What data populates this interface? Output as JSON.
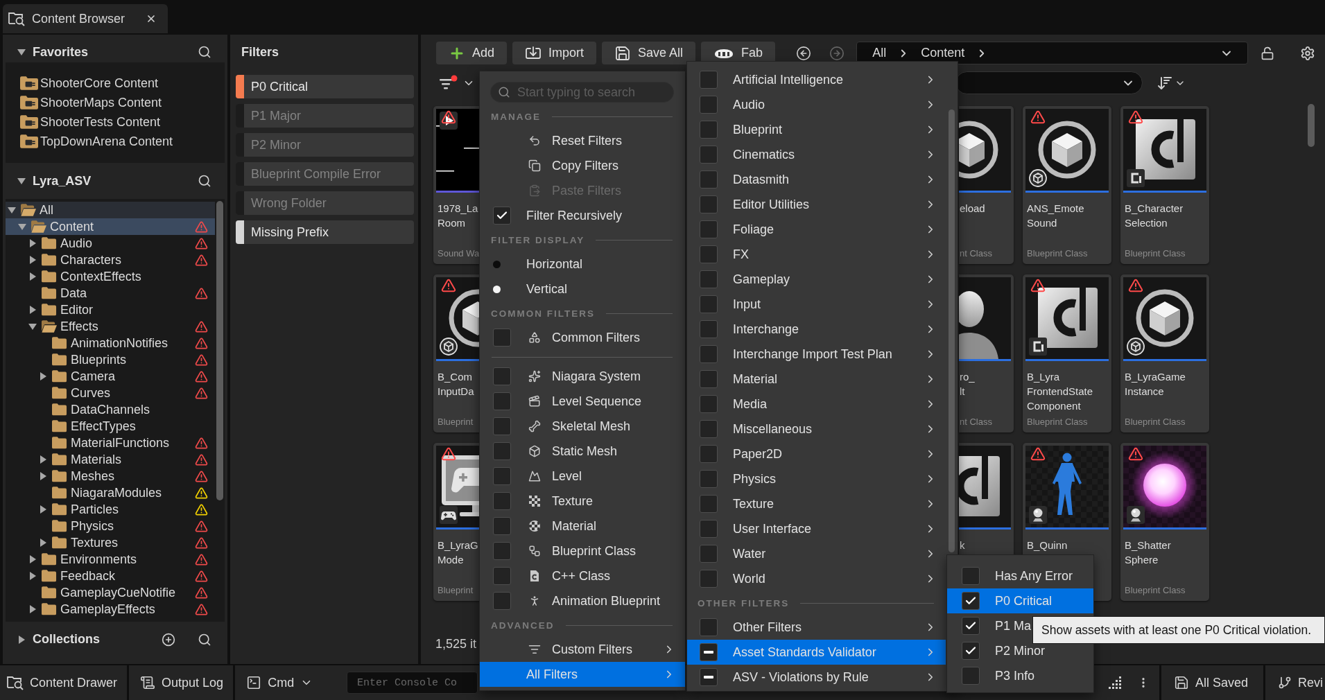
{
  "tab": {
    "title": "Content Browser"
  },
  "sidebar": {
    "favorites": {
      "title": "Favorites",
      "expanded": true,
      "items": [
        "ShooterCore Content",
        "ShooterMaps Content",
        "ShooterTests Content",
        "TopDownArena Content"
      ]
    },
    "project": {
      "title": "Lyra_ASV",
      "expanded": true,
      "tree": [
        {
          "label": "All",
          "kind": "branch",
          "expanded": true,
          "warning": false,
          "selected": false,
          "hovered": true,
          "children": [
            {
              "label": "Content",
              "kind": "branch",
              "expanded": true,
              "warning": true,
              "color": "#f04a4a",
              "selected": true,
              "hovered": false,
              "children": [
                {
                  "label": "Audio",
                  "kind": "branch",
                  "expanded": false,
                  "warning": true,
                  "color": "#f04a4a",
                  "selected": false,
                  "hovered": false
                },
                {
                  "label": "Characters",
                  "kind": "branch",
                  "expanded": false,
                  "warning": true,
                  "color": "#f04a4a",
                  "selected": false,
                  "hovered": false
                },
                {
                  "label": "ContextEffects",
                  "kind": "branch",
                  "expanded": false,
                  "warning": false,
                  "selected": false,
                  "hovered": false
                },
                {
                  "label": "Data",
                  "kind": "leaf",
                  "warning": true,
                  "color": "#f04a4a",
                  "selected": false,
                  "hovered": false
                },
                {
                  "label": "Editor",
                  "kind": "branch",
                  "expanded": false,
                  "warning": false,
                  "selected": false,
                  "hovered": false
                },
                {
                  "label": "Effects",
                  "kind": "branch",
                  "expanded": true,
                  "warning": true,
                  "color": "#f04a4a",
                  "selected": false,
                  "hovered": false,
                  "children": [
                    {
                      "label": "AnimationNotifies",
                      "kind": "leaf",
                      "warning": true,
                      "color": "#f04a4a",
                      "selected": false,
                      "hovered": false
                    },
                    {
                      "label": "Blueprints",
                      "kind": "leaf",
                      "warning": true,
                      "color": "#f04a4a",
                      "selected": false,
                      "hovered": false
                    },
                    {
                      "label": "Camera",
                      "kind": "branch",
                      "expanded": false,
                      "warning": true,
                      "color": "#f04a4a",
                      "selected": false,
                      "hovered": false
                    },
                    {
                      "label": "Curves",
                      "kind": "leaf",
                      "warning": true,
                      "color": "#f04a4a",
                      "selected": false,
                      "hovered": false
                    },
                    {
                      "label": "DataChannels",
                      "kind": "leaf",
                      "warning": false,
                      "selected": false,
                      "hovered": false
                    },
                    {
                      "label": "EffectTypes",
                      "kind": "leaf",
                      "warning": false,
                      "selected": false,
                      "hovered": false
                    },
                    {
                      "label": "MaterialFunctions",
                      "kind": "leaf",
                      "warning": true,
                      "color": "#f04a4a",
                      "selected": false,
                      "hovered": false
                    },
                    {
                      "label": "Materials",
                      "kind": "branch",
                      "expanded": false,
                      "warning": true,
                      "color": "#f04a4a",
                      "selected": false,
                      "hovered": false
                    },
                    {
                      "label": "Meshes",
                      "kind": "branch",
                      "expanded": false,
                      "warning": true,
                      "color": "#f04a4a",
                      "selected": false,
                      "hovered": false
                    },
                    {
                      "label": "NiagaraModules",
                      "kind": "leaf",
                      "warning": true,
                      "color": "#f2d000",
                      "selected": false,
                      "hovered": false
                    },
                    {
                      "label": "Particles",
                      "kind": "branch",
                      "expanded": false,
                      "warning": true,
                      "color": "#f2d000",
                      "selected": false,
                      "hovered": false
                    },
                    {
                      "label": "Physics",
                      "kind": "leaf",
                      "warning": true,
                      "color": "#f04a4a",
                      "selected": false,
                      "hovered": false
                    },
                    {
                      "label": "Textures",
                      "kind": "branch",
                      "expanded": false,
                      "warning": true,
                      "color": "#f04a4a",
                      "selected": false,
                      "hovered": false
                    }
                  ]
                },
                {
                  "label": "Environments",
                  "kind": "branch",
                  "expanded": false,
                  "warning": true,
                  "color": "#f04a4a",
                  "selected": false,
                  "hovered": false
                },
                {
                  "label": "Feedback",
                  "kind": "branch",
                  "expanded": false,
                  "warning": true,
                  "color": "#f04a4a",
                  "selected": false,
                  "hovered": false
                },
                {
                  "label": "GameplayCueNotifie",
                  "kind": "leaf",
                  "warning": true,
                  "color": "#f04a4a",
                  "selected": false,
                  "hovered": false
                },
                {
                  "label": "GameplayEffects",
                  "kind": "branch",
                  "expanded": false,
                  "warning": true,
                  "color": "#f04a4a",
                  "selected": false,
                  "hovered": false
                }
              ]
            }
          ]
        }
      ]
    },
    "collections": {
      "title": "Collections",
      "expanded": false
    }
  },
  "filters": {
    "title": "Filters",
    "chips": [
      {
        "label": "P0 Critical",
        "active": true,
        "color": "#f47b4f"
      },
      {
        "label": "P1 Major",
        "active": false,
        "color": "#1c1c1c"
      },
      {
        "label": "P2 Minor",
        "active": false,
        "color": "#1c1c1c"
      },
      {
        "label": "Blueprint Compile Error",
        "active": false,
        "color": "#1c1c1c"
      },
      {
        "label": "Wrong Folder",
        "active": false,
        "color": "#1c1c1c"
      },
      {
        "label": "Missing Prefix",
        "active": true,
        "color": "#d6d6d6"
      }
    ]
  },
  "toolbar": {
    "buttons": [
      {
        "kind": "add",
        "label": "Add"
      },
      {
        "kind": "import",
        "label": "Import"
      },
      {
        "kind": "save",
        "label": "Save All"
      },
      {
        "kind": "fab",
        "label": "Fab"
      }
    ],
    "path": [
      "All",
      "Content"
    ]
  },
  "assets": {
    "rows": [
      [
        {
          "kind": "sound",
          "name": [
            "1978_La",
            "Room"
          ],
          "type": "Sound Wa",
          "warning": true,
          "color": "#5f57d9"
        },
        {
          "kind": "cube",
          "name": [
            "eload"
          ],
          "type": "nt Class",
          "warning": false,
          "color": "#2c6fe0"
        },
        {
          "kind": "cube",
          "name": [
            "ANS_Emote",
            "Sound"
          ],
          "type": "Blueprint Class",
          "warning": true,
          "color": "#2c6fe0"
        },
        {
          "kind": "class",
          "name": [
            "B_Character",
            "Selection"
          ],
          "type": "Blueprint Class",
          "warning": true,
          "color": "#2c6fe0"
        }
      ],
      [
        {
          "kind": "cube",
          "name": [
            "B_Com",
            "InputDa"
          ],
          "type": "Blueprint",
          "warning": true,
          "color": "#2c6fe0"
        },
        {
          "kind": "head",
          "name": [
            "ro_",
            "lt"
          ],
          "type": "nt Class",
          "warning": false,
          "color": "#2c6fe0"
        },
        {
          "kind": "class",
          "name": [
            "B_Lyra",
            "FrontendState",
            "Component"
          ],
          "type": "Blueprint Class",
          "warning": true,
          "color": "#2c6fe0"
        },
        {
          "kind": "cube",
          "name": [
            "B_LyraGame",
            "Instance"
          ],
          "type": "Blueprint Class",
          "warning": true,
          "color": "#2c6fe0"
        }
      ],
      [
        {
          "kind": "monitor",
          "name": [
            "B_LyraG",
            "Mode"
          ],
          "type": "Blueprint",
          "warning": true,
          "color": "#2c6fe0"
        },
        {
          "kind": "class",
          "name": [
            "k"
          ],
          "warning": false,
          "color": "#2c6fe0"
        },
        {
          "kind": "mannequin",
          "name": [
            "B_Quinn"
          ],
          "warning": true,
          "color": "#2c6fe0"
        },
        {
          "kind": "sphere",
          "name": [
            "B_Shatter",
            "Sphere"
          ],
          "type": "Blueprint Class",
          "warning": true,
          "color": "#2c6fe0"
        }
      ]
    ],
    "count": "1,525 it"
  },
  "filter_menu": {
    "search": {
      "placeholder": "Start typing to search"
    },
    "manage": {
      "heading": "MANAGE",
      "actions": [
        {
          "label": "Reset Filters",
          "disabled": false
        },
        {
          "label": "Copy Filters",
          "disabled": false
        },
        {
          "label": "Paste Filters",
          "disabled": true
        }
      ],
      "recursive": {
        "label": "Filter Recursively",
        "checked": true
      }
    },
    "display": {
      "heading": "FILTER DISPLAY",
      "options": [
        {
          "label": "Horizontal",
          "selected": false
        },
        {
          "label": "Vertical",
          "selected": true
        }
      ]
    },
    "common": {
      "heading": "COMMON FILTERS",
      "toggle": {
        "label": "Common Filters",
        "checked": false
      },
      "types": [
        {
          "label": "Niagara System",
          "checked": false
        },
        {
          "label": "Level Sequence",
          "checked": false
        },
        {
          "label": "Skeletal Mesh",
          "checked": false
        },
        {
          "label": "Static Mesh",
          "checked": false
        },
        {
          "label": "Level",
          "checked": false
        },
        {
          "label": "Texture",
          "checked": false
        },
        {
          "label": "Material",
          "checked": false
        },
        {
          "label": "Blueprint Class",
          "checked": false
        },
        {
          "label": "C++ Class",
          "checked": false
        },
        {
          "label": "Animation Blueprint",
          "checked": false
        }
      ]
    },
    "advanced": {
      "heading": "ADVANCED",
      "items": [
        {
          "label": "Custom Filters",
          "highlighted": false
        },
        {
          "label": "All Filters",
          "highlighted": true
        }
      ]
    }
  },
  "all_filters_menu": {
    "categories": [
      {
        "label": "Artificial Intelligence",
        "checked": false
      },
      {
        "label": "Audio",
        "checked": false
      },
      {
        "label": "Blueprint",
        "checked": false
      },
      {
        "label": "Cinematics",
        "checked": false
      },
      {
        "label": "Datasmith",
        "checked": false
      },
      {
        "label": "Editor Utilities",
        "checked": false
      },
      {
        "label": "Foliage",
        "checked": false
      },
      {
        "label": "FX",
        "checked": false
      },
      {
        "label": "Gameplay",
        "checked": false
      },
      {
        "label": "Input",
        "checked": false
      },
      {
        "label": "Interchange",
        "checked": false
      },
      {
        "label": "Interchange Import Test Plan",
        "checked": false
      },
      {
        "label": "Material",
        "checked": false
      },
      {
        "label": "Media",
        "checked": false
      },
      {
        "label": "Miscellaneous",
        "checked": false
      },
      {
        "label": "Paper2D",
        "checked": false
      },
      {
        "label": "Physics",
        "checked": false
      },
      {
        "label": "Texture",
        "checked": false
      },
      {
        "label": "User Interface",
        "checked": false
      },
      {
        "label": "Water",
        "checked": false
      },
      {
        "label": "World",
        "checked": false
      }
    ],
    "other_heading": "OTHER FILTERS",
    "other": [
      {
        "label": "Other Filters",
        "checked": false,
        "mixed": false,
        "highlighted": false
      },
      {
        "label": "Asset Standards Validator",
        "checked": true,
        "mixed": true,
        "highlighted": true
      },
      {
        "label": "ASV - Violations by Rule",
        "checked": true,
        "mixed": true,
        "highlighted": false
      }
    ]
  },
  "asv_menu": {
    "items": [
      {
        "label": "Has Any Error",
        "checked": false,
        "highlighted": false
      },
      {
        "label": "P0 Critical",
        "checked": true,
        "highlighted": true
      },
      {
        "label": "P1 Ma",
        "checked": true,
        "highlighted": false
      },
      {
        "label": "P2 Minor",
        "checked": true,
        "highlighted": false
      },
      {
        "label": "P3 Info",
        "checked": false,
        "highlighted": false
      }
    ]
  },
  "tooltip": {
    "text": "Show assets with at least one P0 Critical violation."
  },
  "status_bar": {
    "left": [
      {
        "kind": "drawer",
        "label": "Content Drawer"
      },
      {
        "kind": "log",
        "label": "Output Log"
      },
      {
        "kind": "cmd",
        "label": "Cmd"
      }
    ],
    "console": {
      "placeholder": "Enter Console Co"
    },
    "right": [
      {
        "kind": "saved",
        "label": "All Saved"
      },
      {
        "kind": "revision",
        "label": "Revi"
      }
    ]
  }
}
